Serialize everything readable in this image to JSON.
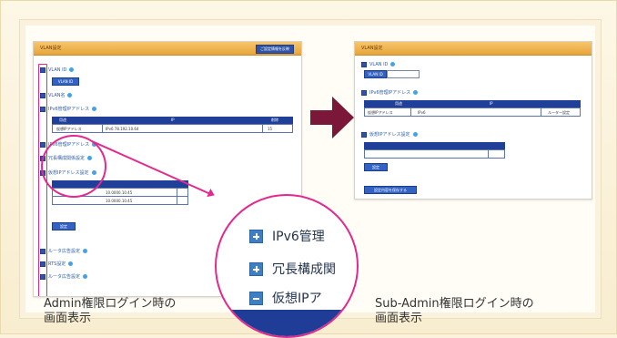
{
  "left_screen": {
    "title": "VLAN設定",
    "top_tag": "ご設定情報を反映",
    "rows": [
      "VLAN ID",
      "VLAN ID",
      "VLAN名",
      "IPv6管理IPアドレス",
      "IPv6管理IPアドレス",
      "冗長構成関係設定",
      "仮想IPアドレス設定",
      "ルータ広告設定",
      "RTS設定",
      "ルータ広告設定"
    ],
    "table_head": [
      "用途",
      "IP",
      "削除"
    ],
    "table_rows": [
      [
        "仮想IPアドレス",
        "IPv6 78.192.10.64",
        "15"
      ]
    ],
    "subtable_rows": [
      "10.0000.10.45",
      "10.0000.10.45"
    ],
    "button": "設定"
  },
  "magnifier": {
    "rows": [
      "IPv6管理",
      "冗長構成関",
      "仮想IPア"
    ]
  },
  "right_screen": {
    "title": "VLAN設定",
    "rows": [
      "VLAN ID",
      "VLAN ID",
      "IPv6管理IPアドレス",
      "仮想IPアドレス設定"
    ],
    "table_head": [
      "用途",
      "IP"
    ],
    "table_rows": [
      [
        "仮想IPアドレス",
        "IPv6",
        "ルーター設定"
      ]
    ],
    "button": "設定",
    "save_button": "設定内容を保存する"
  },
  "captions": {
    "left_line1": "Admin権限ログイン時の",
    "left_line2": "画面表示",
    "right_line1": "Sub-Admin権限ログイン時の",
    "right_line2": "画面表示"
  },
  "colors": {
    "highlight": "#e3288e",
    "arrow": "#7b1738",
    "header": "#e7a53b",
    "table": "#1f3f99"
  }
}
